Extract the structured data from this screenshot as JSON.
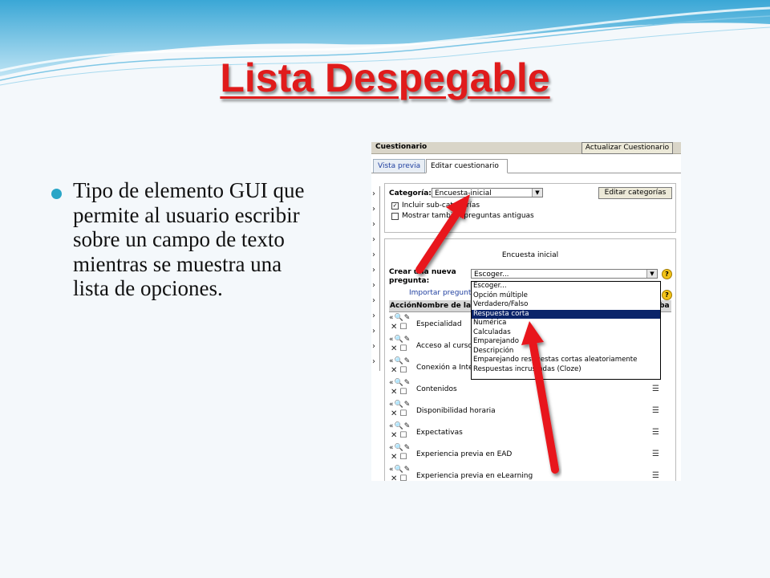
{
  "slide": {
    "title": "Lista Despegable",
    "bullet": "Tipo de elemento GUI que permite al usuario escribir sobre un campo de texto mientras se muestra una lista de opciones."
  },
  "screenshot": {
    "top_title": "Cuestionario",
    "update_button": "Actualizar Cuestionario",
    "tabs": [
      "Vista previa",
      "Editar cuestionario"
    ],
    "category_label": "Categoría:",
    "category_value": "Encuesta-inicial",
    "edit_categories_button": "Editar categorías",
    "include_subcategories": "Incluir sub-categorías",
    "include_subcategories_checked": true,
    "show_old_questions": "Mostrar también preguntas antiguas",
    "panel_heading": "Encuesta inicial",
    "create_label_1": "Crear una nueva",
    "create_label_2": "pregunta:",
    "select_value": "Escoger...",
    "import_link": "Importar preguntas",
    "table_headers": {
      "action": "Acción",
      "name": "Nombre de la",
      "right": "iba"
    },
    "options": [
      "Escoger...",
      "Opción múltiple",
      "Verdadero/Falso",
      "Respuesta corta",
      "Numérica",
      "Calculadas",
      "Emparejando",
      "Descripción",
      "Emparejando respuestas cortas aleatoriamente",
      "Respuestas incrustadas (Cloze)"
    ],
    "highlighted_option": "Respuesta corta",
    "rows": [
      "Especialidad",
      "Acceso al curso",
      "Conexión a Inter",
      "Contenidos",
      "Disponibilidad horaria",
      "Expectativas",
      "Experiencia previa en EAD",
      "Experiencia previa en eLearning"
    ]
  },
  "colors": {
    "title": "#e01b1b",
    "bullet": "#2aa6c7",
    "highlight": "#0a246a",
    "arrow": "#e8141c"
  }
}
